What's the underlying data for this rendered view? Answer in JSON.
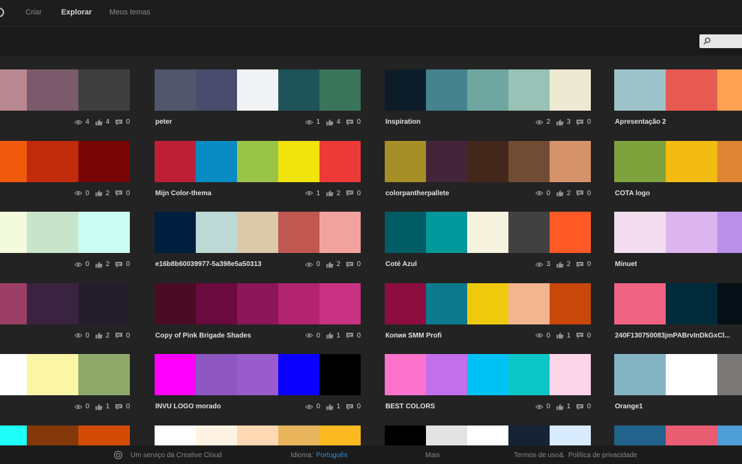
{
  "nav": {
    "create": "Criar",
    "explore": "Explorar",
    "my_themes": "Meus temas"
  },
  "search": {
    "placeholder": ""
  },
  "themes": [
    [
      {
        "title": "",
        "colors": [
          "#C9A2AD",
          "#B98891",
          "#7B5B6B",
          "#3F3F3F"
        ],
        "views": "4",
        "likes": "4",
        "comments": "0"
      },
      {
        "title": "peter",
        "colors": [
          "#52566A",
          "#4A4C6E",
          "#F2F3F5",
          "#1E5459",
          "#3A745A"
        ],
        "views": "1",
        "likes": "4",
        "comments": "0"
      },
      {
        "title": "Inspiration",
        "colors": [
          "#0C1C29",
          "#44838E",
          "#70A6A0",
          "#97C2B5",
          "#EEE9D3"
        ],
        "views": "2",
        "likes": "3",
        "comments": "0"
      },
      {
        "title": "Apresentação 2",
        "colors": [
          "#9CC3C9",
          "#E65A52",
          "#FEA152",
          "#8E55E8"
        ],
        "views": "",
        "likes": "",
        "comments": ""
      }
    ],
    [
      {
        "title": "",
        "colors": [
          "#F58220",
          "#F15A0D",
          "#C22A0C",
          "#780606"
        ],
        "views": "0",
        "likes": "2",
        "comments": "0"
      },
      {
        "title": "Mijn Color-thema",
        "colors": [
          "#BE1F37",
          "#078BC1",
          "#9AC447",
          "#F0E40C",
          "#EE3A37"
        ],
        "views": "1",
        "likes": "2",
        "comments": "0"
      },
      {
        "title": "colorpantherpallete",
        "colors": [
          "#A68F27",
          "#43253A",
          "#43271A",
          "#704C34",
          "#D6936A"
        ],
        "views": "0",
        "likes": "2",
        "comments": "0"
      },
      {
        "title": "COTA logo",
        "colors": [
          "#7EA33D",
          "#F3BC12",
          "#DD8532",
          "#E05A22"
        ],
        "views": "",
        "likes": "",
        "comments": ""
      }
    ],
    [
      {
        "title": "",
        "colors": [
          "#BFB3A0",
          "#F4FADC",
          "#C8E4CA",
          "#CBFCF1"
        ],
        "views": "0",
        "likes": "2",
        "comments": "0"
      },
      {
        "title": "e16b8b60039977-5a398e5a50313",
        "colors": [
          "#001F3F",
          "#BDD9D6",
          "#DBC9A9",
          "#C05750",
          "#F3A39F"
        ],
        "views": "0",
        "likes": "2",
        "comments": "0"
      },
      {
        "title": "Coté Azul",
        "colors": [
          "#005C65",
          "#00989A",
          "#F5F2DE",
          "#414141",
          "#FF5A26"
        ],
        "views": "3",
        "likes": "2",
        "comments": "0"
      },
      {
        "title": "Minuet",
        "colors": [
          "#F2DEEE",
          "#DDB6F0",
          "#BA90EB",
          "#C5E5EE"
        ],
        "views": "",
        "likes": "",
        "comments": ""
      }
    ],
    [
      {
        "title": "",
        "colors": [
          "#E86C5E",
          "#9C3F64",
          "#3A2340",
          "#241E2C"
        ],
        "views": "0",
        "likes": "2",
        "comments": "0"
      },
      {
        "title": "Copy of Pink Brigade Shades",
        "colors": [
          "#4A0B24",
          "#6A0A3D",
          "#8B1759",
          "#B2246D",
          "#C93282"
        ],
        "views": "0",
        "likes": "1",
        "comments": "0"
      },
      {
        "title": "Копия SMM Profi",
        "colors": [
          "#8C0C40",
          "#0C7A8C",
          "#EFCA0C",
          "#F1B58F",
          "#C9470A"
        ],
        "views": "0",
        "likes": "1",
        "comments": "0"
      },
      {
        "title": "240F130750083jmPABrvInDkGxCl...",
        "colors": [
          "#F06382",
          "#002B3B",
          "#051016",
          "#0C5F6E"
        ],
        "views": "",
        "likes": "",
        "comments": ""
      }
    ],
    [
      {
        "title": "",
        "colors": [
          "#D63A4F",
          "#FFFFFF",
          "#FAF6A6",
          "#8FA96B"
        ],
        "views": "0",
        "likes": "1",
        "comments": "0"
      },
      {
        "title": "INVU LOGO morado",
        "colors": [
          "#FF00FF",
          "#8D56C0",
          "#9A5CCC",
          "#0A00FE",
          "#000000"
        ],
        "views": "0",
        "likes": "1",
        "comments": "0"
      },
      {
        "title": "BEST COLORS",
        "colors": [
          "#FC72CC",
          "#C36FEC",
          "#00C2F5",
          "#0DC7C7",
          "#FDD5E9"
        ],
        "views": "0",
        "likes": "1",
        "comments": "0"
      },
      {
        "title": "Orange1",
        "colors": [
          "#85B5C4",
          "#FFFFFF",
          "#7A7777",
          "#1FA7BF"
        ],
        "views": "",
        "likes": "",
        "comments": ""
      }
    ],
    [
      {
        "title": "",
        "colors": [
          "#1ABCC4",
          "#1EFFFA",
          "#843709",
          "#D24C06"
        ],
        "views": "",
        "likes": "",
        "comments": ""
      },
      {
        "title": "",
        "colors": [
          "#FFFFFF",
          "#FFF4E3",
          "#FFD9B3",
          "#E8B45C",
          "#FDB922"
        ],
        "views": "",
        "likes": "",
        "comments": ""
      },
      {
        "title": "",
        "colors": [
          "#000000",
          "#E3E3E3",
          "#FFFFFF",
          "#162335",
          "#D9EBFF"
        ],
        "views": "",
        "likes": "",
        "comments": ""
      },
      {
        "title": "",
        "colors": [
          "#21638B",
          "#E85D71",
          "#4E9FD8",
          "#8E9A2D"
        ],
        "views": "",
        "likes": "",
        "comments": ""
      }
    ]
  ],
  "footer": {
    "service": "Um serviço da Creative Cloud",
    "language_label": "Idioma:",
    "language_value": "Português",
    "more": "Mais",
    "terms": "Termos de uso",
    "amp": "&",
    "privacy": "Política de privacidade"
  }
}
